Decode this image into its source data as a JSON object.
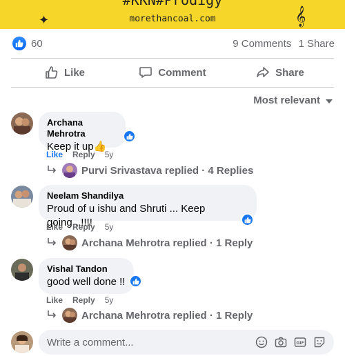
{
  "banner": {
    "title": "#KKN#Prodigy",
    "site": "morethancoal.com",
    "sparkle_icon": "✦",
    "clef_icon": "𝄞"
  },
  "stats": {
    "like_count": "60",
    "comments": "9 Comments",
    "shares": "1 Share"
  },
  "actions": {
    "like": "Like",
    "comment": "Comment",
    "share": "Share"
  },
  "sort": {
    "label": "Most relevant"
  },
  "comments": [
    {
      "name": "Archana Mehrotra",
      "text": "Keep it up👍",
      "like": "Like",
      "reply": "Reply",
      "time": "5y",
      "liked": true,
      "replies": "Purvi Srivastava replied · 4 Replies"
    },
    {
      "name": "Neelam Shandilya",
      "text": "Proud of u ishu and Shruti ... Keep going...!!!!",
      "like": "Like",
      "reply": "Reply",
      "time": "5y",
      "liked": false,
      "replies": "Archana Mehrotra replied · 1 Reply"
    },
    {
      "name": "Vishal Tandon",
      "text": "good well done !!",
      "like": "Like",
      "reply": "Reply",
      "time": "5y",
      "liked": false,
      "replies": "Archana Mehrotra replied · 1 Reply"
    }
  ],
  "composer": {
    "placeholder": "Write a comment..."
  },
  "colors": {
    "banner": "#f7d62a",
    "accent": "#1877f2",
    "muted": "#65676b",
    "bubble": "#f0f2f5"
  }
}
